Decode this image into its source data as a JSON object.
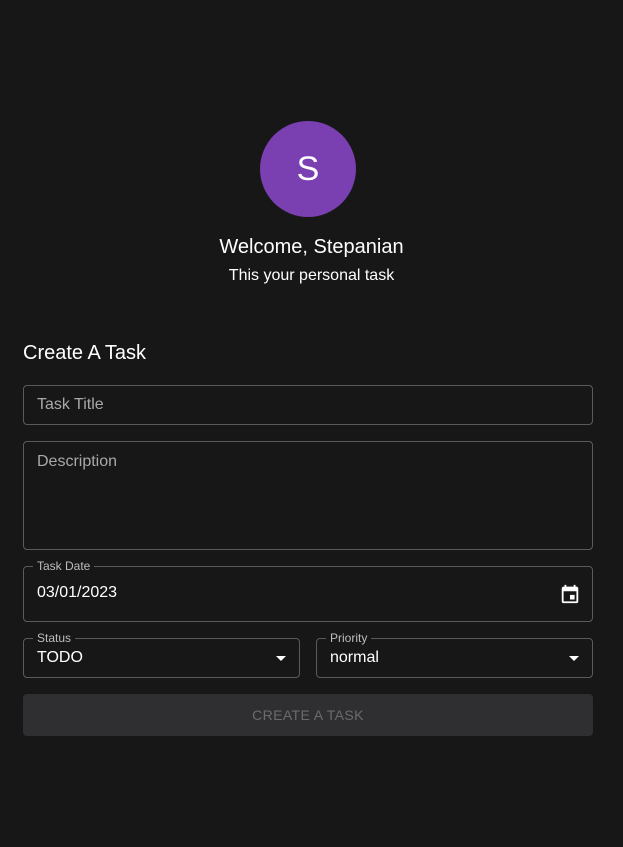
{
  "user": {
    "avatar_initial": "S",
    "welcome": "Welcome, Stepanian",
    "subtitle": "This your personal task"
  },
  "form": {
    "heading": "Create A Task",
    "title_placeholder": "Task Title",
    "description_placeholder": "Description",
    "date": {
      "label": "Task Date",
      "value": "03/01/2023",
      "icon": "calendar-icon"
    },
    "status": {
      "label": "Status",
      "value": "TODO",
      "icon": "dropdown-arrow-icon"
    },
    "priority": {
      "label": "Priority",
      "value": "normal",
      "icon": "dropdown-arrow-icon"
    },
    "submit_label": "CREATE A TASK"
  },
  "colors": {
    "background": "#171718",
    "avatar": "#7a3fb0",
    "border": "#5a5a5c",
    "button_disabled_bg": "#2f2f31",
    "button_disabled_text": "#6b6b6e"
  }
}
